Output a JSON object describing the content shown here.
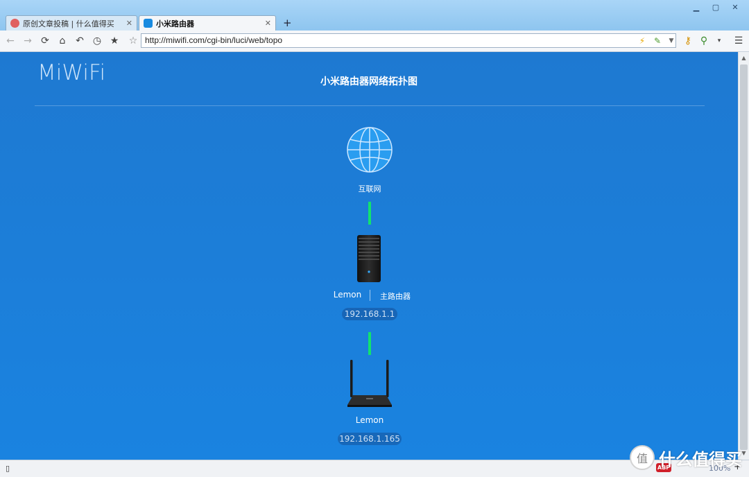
{
  "browser": {
    "tabs": [
      {
        "label": "原创文章投稿 | 什么值得买",
        "active": false
      },
      {
        "label": "小米路由器",
        "active": true
      }
    ],
    "new_tab_label": "+",
    "address": "http://miwifi.com/cgi-bin/luci/web/topo",
    "toolbar_icons": [
      "back-icon",
      "forward-icon",
      "refresh-icon",
      "home-icon",
      "undo-icon",
      "history-icon",
      "favorites-icon",
      "bookmark-star-icon"
    ],
    "zoom": "100%"
  },
  "page": {
    "logo": "MiWiFi",
    "title": "小米路由器网络拓扑图",
    "internet_label": "互联网",
    "main_router": {
      "name": "Lemon",
      "role": "主路由器",
      "ip": "192.168.1.1"
    },
    "sub_router": {
      "name": "Lemon",
      "ip": "192.168.1.165"
    }
  },
  "statusbar": {
    "abp": "ABP",
    "zoom": "100%"
  },
  "watermark": {
    "text": "什么值得买",
    "badge": "值"
  },
  "colors": {
    "page_bg": "#1a7fd8",
    "link_line": "#12e26e",
    "window_frame": "#8fc6ef"
  }
}
